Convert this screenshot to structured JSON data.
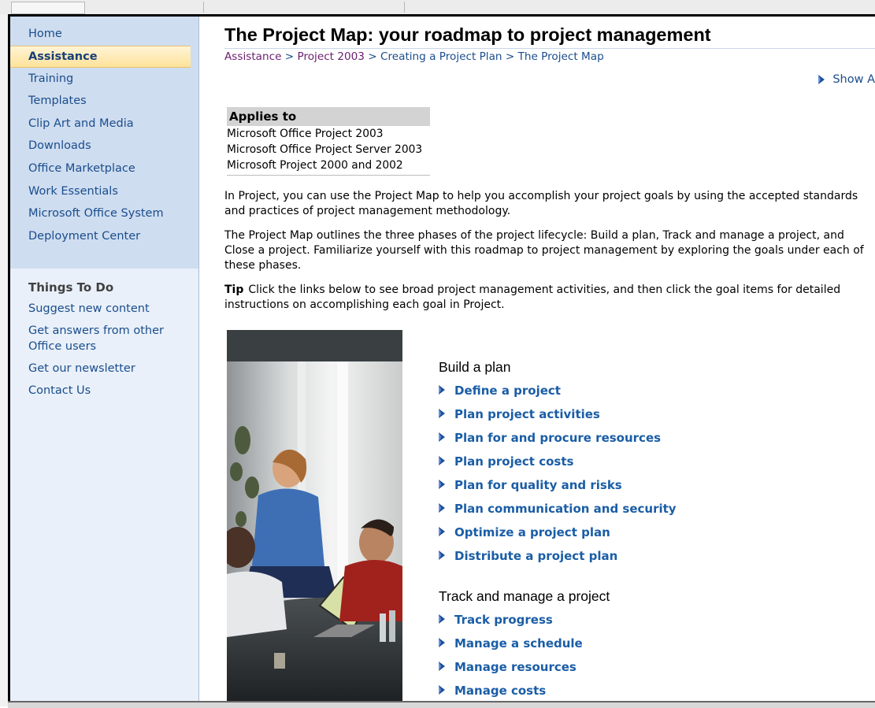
{
  "sidebar": {
    "nav": [
      "Home",
      "Assistance",
      "Training",
      "Templates",
      "Clip Art and Media",
      "Downloads",
      "Office Marketplace",
      "Work Essentials",
      "Microsoft Office System",
      "Deployment Center"
    ],
    "active_index": 1,
    "things_heading": "Things To Do",
    "things": [
      "Suggest new content",
      "Get answers from other Office users",
      "Get our newsletter",
      "Contact Us"
    ]
  },
  "main": {
    "title": "The Project Map: your roadmap to project management",
    "breadcrumb": {
      "items": [
        "Assistance",
        "Project 2003",
        "Creating a Project Plan",
        "The Project Map"
      ],
      "separator": ">"
    },
    "show_all": "Show A",
    "applies_to": {
      "heading": "Applies to",
      "items": [
        "Microsoft Office Project 2003",
        "Microsoft Office Project Server 2003",
        "Microsoft Project 2000 and 2002"
      ]
    },
    "para1": "In Project, you can use the Project Map to help you accomplish your project goals by using the accepted standards and practices of project management methodology.",
    "para2": "The Project Map outlines the three phases of the project lifecycle: Build a plan, Track and manage a project, and Close a project. Familiarize yourself with this roadmap to project management by exploring the goals under each of these phases.",
    "tip_label": "Tip",
    "tip_text": "Click the links below to see broad project management activities, and then click the goal items for detailed instructions on accomplishing each goal in Project.",
    "sections": [
      {
        "heading": "Build a plan",
        "links": [
          "Define a project",
          "Plan project activities",
          "Plan for and procure resources",
          "Plan project costs",
          "Plan for quality and risks",
          "Plan communication and security",
          "Optimize a project plan",
          "Distribute a project plan"
        ]
      },
      {
        "heading": "Track and manage a project",
        "links": [
          "Track progress",
          "Manage a schedule",
          "Manage resources",
          "Manage costs"
        ]
      }
    ]
  },
  "colors": {
    "sidebar_bg": "#cfddf0",
    "link": "#1a4d8c",
    "goal_link": "#1a5da6",
    "active_item": "#fde29a"
  }
}
